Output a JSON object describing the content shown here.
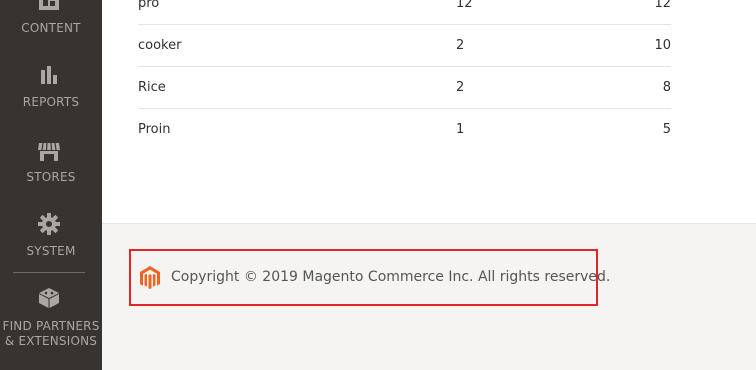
{
  "sidebar": {
    "items": [
      {
        "label": "CONTENT",
        "icon": "content-icon"
      },
      {
        "label": "REPORTS",
        "icon": "reports-icon"
      },
      {
        "label": "STORES",
        "icon": "stores-icon"
      },
      {
        "label": "SYSTEM",
        "icon": "gear-icon"
      },
      {
        "label_line1": "FIND PARTNERS",
        "label_line2": "& EXTENSIONS",
        "icon": "partners-icon"
      }
    ]
  },
  "table": {
    "rows": [
      {
        "product": "pro",
        "quantity": "12",
        "total": "12"
      },
      {
        "product": "cooker",
        "quantity": "2",
        "total": "10"
      },
      {
        "product": "Rice",
        "quantity": "2",
        "total": "8"
      },
      {
        "product": "Proin",
        "quantity": "1",
        "total": "5"
      }
    ]
  },
  "footer": {
    "copyright": "Copyright © 2019 Magento Commerce Inc. All rights reserved.",
    "logo_icon": "magento-logo-icon",
    "brand_color": "#f26322",
    "highlight_color": "#e22626"
  }
}
